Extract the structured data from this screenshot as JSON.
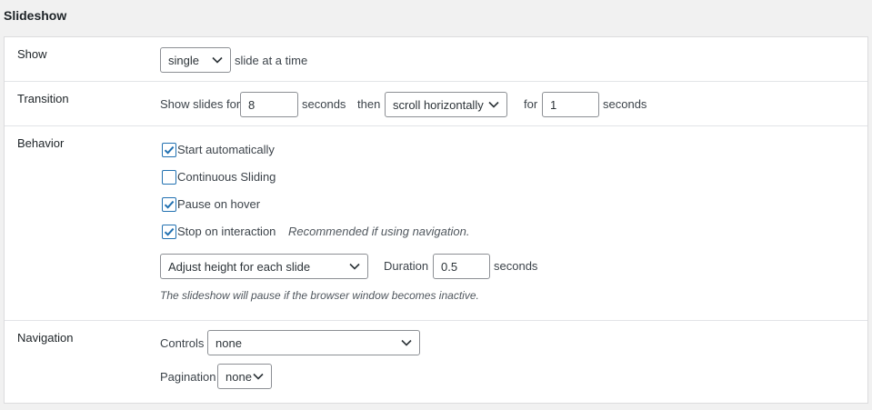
{
  "section_title": "Slideshow",
  "rows": {
    "show": {
      "label": "Show",
      "select_value": "single",
      "suffix": "slide at a time"
    },
    "transition": {
      "label": "Transition",
      "prefix": "Show slides for",
      "duration_value": "8",
      "seconds_1": "seconds",
      "then": "then",
      "effect_value": "scroll horizontally",
      "for": "for",
      "for_value": "1",
      "seconds_2": "seconds"
    },
    "behavior": {
      "label": "Behavior",
      "options": [
        {
          "label": "Start automatically",
          "checked": true
        },
        {
          "label": "Continuous Sliding",
          "checked": false
        },
        {
          "label": "Pause on hover",
          "checked": true
        },
        {
          "label": "Stop on interaction",
          "checked": true
        }
      ],
      "stop_hint": "Recommended if using navigation.",
      "height_select_value": "Adjust height for each slide",
      "duration_label": "Duration",
      "duration_value": "0.5",
      "duration_unit": "seconds",
      "note": "The slideshow will pause if the browser window becomes inactive."
    },
    "navigation": {
      "label": "Navigation",
      "controls_label": "Controls",
      "controls_value": "none",
      "pagination_label": "Pagination",
      "pagination_value": "none"
    }
  },
  "colors": {
    "accent": "#2271b1",
    "background": "#f1f1f1",
    "panel": "#ffffff"
  },
  "icons": {
    "dropdown": "chevron-down-icon",
    "check": "checkmark-icon"
  }
}
